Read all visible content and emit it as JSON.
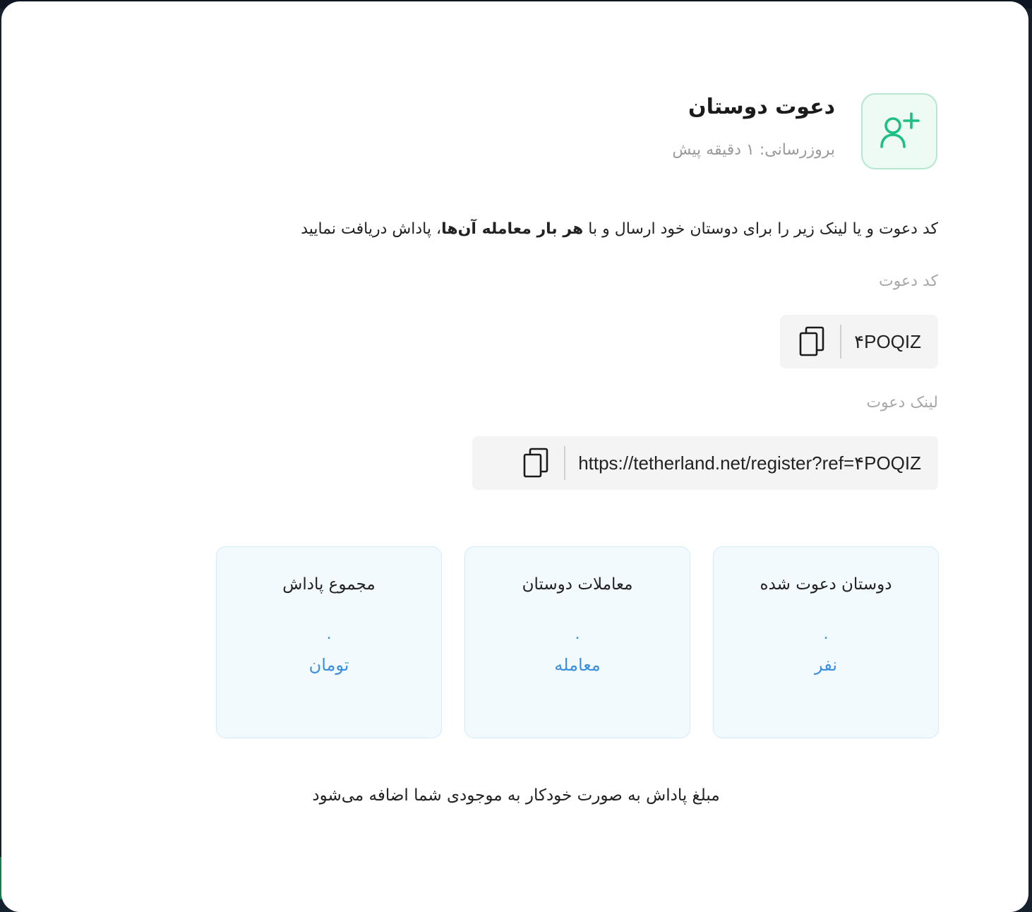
{
  "header": {
    "title": "دعوت دوستان",
    "updated": "بروزرسانی: ۱ دقیقه پیش",
    "icon": "user-plus-icon",
    "accent": "#1dbf84"
  },
  "description": {
    "part1": "کد دعوت و یا لینک زیر را برای دوستان خود ارسال و با ",
    "bold": "هر بار معامله آن‌ها",
    "part2": "، پاداش دریافت نمایید"
  },
  "invite_code": {
    "label": "کد دعوت",
    "value": "۴POQIZ",
    "copy_icon": "copy-icon"
  },
  "invite_link": {
    "label": "لینک دعوت",
    "value": "https://tetherland.net/register?ref=۴POQIZ",
    "copy_icon": "copy-icon"
  },
  "stats": [
    {
      "title": "دوستان دعوت شده",
      "value": "۰",
      "unit": "نفر"
    },
    {
      "title": "معاملات دوستان",
      "value": "۰",
      "unit": "معامله"
    },
    {
      "title": "مجموع پاداش",
      "value": "۰",
      "unit": "تومان"
    }
  ],
  "footer": "مبلغ پاداش به صورت خودکار به موجودی شما اضافه می‌شود",
  "colors": {
    "value_blue": "#3b8fe0",
    "card_bg": "#f3fafd",
    "field_bg": "#f4f4f5"
  }
}
